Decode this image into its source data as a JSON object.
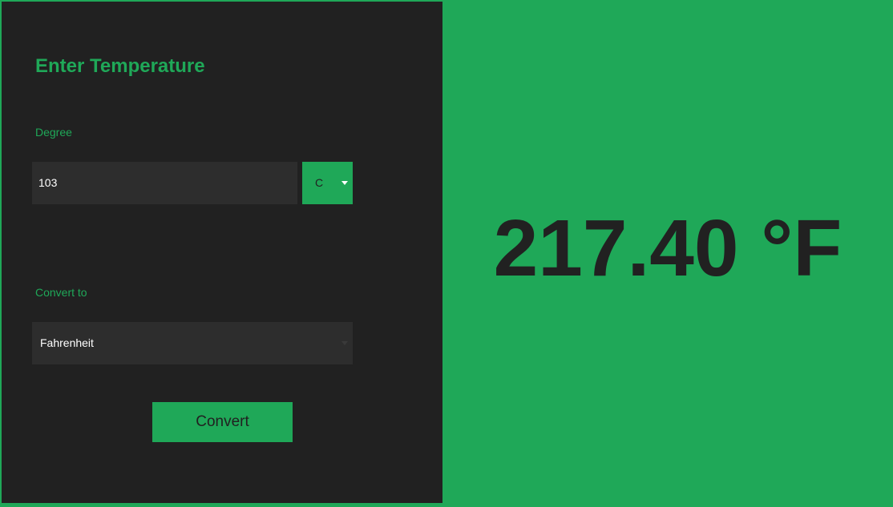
{
  "form": {
    "title": "Enter Temperature",
    "degree_label": "Degree",
    "degree_value": "103",
    "unit_selected": "C",
    "convert_to_label": "Convert to",
    "target_selected": "Fahrenheit",
    "convert_button_label": "Convert"
  },
  "result": {
    "text": "217.40 °F"
  },
  "colors": {
    "accent": "#1fa858",
    "panel_background": "#212121",
    "input_background": "#2d2d2d",
    "result_text": "#212121"
  }
}
